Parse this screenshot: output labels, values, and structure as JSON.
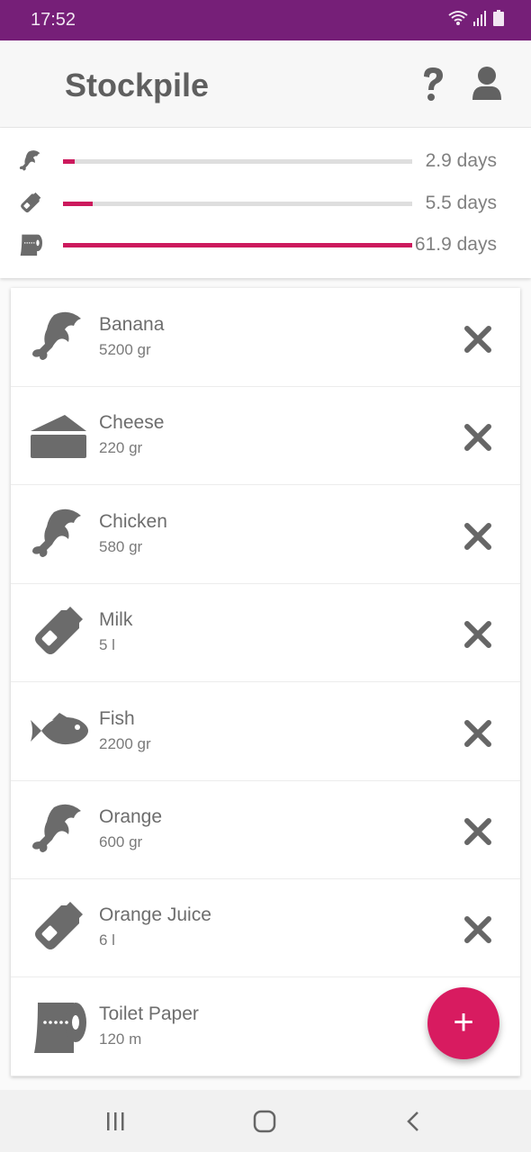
{
  "status_bar": {
    "time": "17:52",
    "icons": [
      "wifi-icon",
      "signal-icon",
      "battery-icon"
    ]
  },
  "app_bar": {
    "title": "Stockpile",
    "help_icon": "help-icon",
    "account_icon": "account-icon"
  },
  "summary": [
    {
      "icon": "food-icon",
      "label": "2.9 days",
      "progress": 0.034
    },
    {
      "icon": "drink-icon",
      "label": "5.5 days",
      "progress": 0.085
    },
    {
      "icon": "toilet-paper-icon",
      "label": "61.9 days",
      "progress": 1.0
    }
  ],
  "items": [
    {
      "name": "Banana",
      "quantity": "5200 gr",
      "icon": "food-icon"
    },
    {
      "name": "Cheese",
      "quantity": "220 gr",
      "icon": "cheese-icon"
    },
    {
      "name": "Chicken",
      "quantity": "580 gr",
      "icon": "food-icon"
    },
    {
      "name": "Milk",
      "quantity": "5 l",
      "icon": "bottle-icon"
    },
    {
      "name": "Fish",
      "quantity": "2200 gr",
      "icon": "fish-icon"
    },
    {
      "name": "Orange",
      "quantity": "600 gr",
      "icon": "food-icon"
    },
    {
      "name": "Orange Juice",
      "quantity": "6 l",
      "icon": "bottle-icon"
    },
    {
      "name": "Toilet Paper",
      "quantity": "120 m",
      "icon": "toilet-paper-icon"
    }
  ],
  "fab": {
    "label": "+"
  },
  "colors": {
    "status_bar": "#761f78",
    "accent": "#d81b60",
    "icon": "#6b6b6b"
  }
}
